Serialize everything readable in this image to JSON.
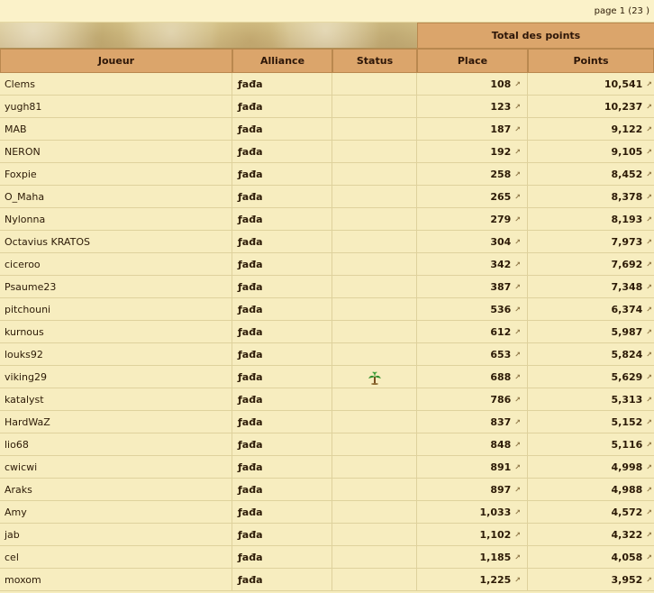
{
  "pager": {
    "text": "page 1 (23 )"
  },
  "table": {
    "group_header": "Total des points",
    "headers": {
      "player": "Joueur",
      "alliance": "Alliance",
      "status": "Status",
      "place": "Place",
      "points": "Points"
    },
    "link_icon_glyph": "↗",
    "rows": [
      {
        "player": "Clems",
        "alliance": "ƒađa",
        "status": "",
        "place": "108",
        "points": "10,541"
      },
      {
        "player": "yugh81",
        "alliance": "ƒađa",
        "status": "",
        "place": "123",
        "points": "10,237"
      },
      {
        "player": "MAB",
        "alliance": "ƒađa",
        "status": "",
        "place": "187",
        "points": "9,122"
      },
      {
        "player": "NERON",
        "alliance": "ƒađa",
        "status": "",
        "place": "192",
        "points": "9,105"
      },
      {
        "player": "Foxpie",
        "alliance": "ƒađa",
        "status": "",
        "place": "258",
        "points": "8,452"
      },
      {
        "player": "O_Maha",
        "alliance": "ƒađa",
        "status": "",
        "place": "265",
        "points": "8,378"
      },
      {
        "player": "Nylonna",
        "alliance": "ƒađa",
        "status": "",
        "place": "279",
        "points": "8,193"
      },
      {
        "player": "Octavius KRATOS",
        "alliance": "ƒađa",
        "status": "",
        "place": "304",
        "points": "7,973"
      },
      {
        "player": "ciceroo",
        "alliance": "ƒađa",
        "status": "",
        "place": "342",
        "points": "7,692"
      },
      {
        "player": "Psaume23",
        "alliance": "ƒađa",
        "status": "",
        "place": "387",
        "points": "7,348"
      },
      {
        "player": "pitchouni",
        "alliance": "ƒađa",
        "status": "",
        "place": "536",
        "points": "6,374"
      },
      {
        "player": "kurnous",
        "alliance": "ƒađa",
        "status": "",
        "place": "612",
        "points": "5,987"
      },
      {
        "player": "louks92",
        "alliance": "ƒađa",
        "status": "",
        "place": "653",
        "points": "5,824"
      },
      {
        "player": "viking29",
        "alliance": "ƒađa",
        "status": "palm-tree-icon",
        "place": "688",
        "points": "5,629"
      },
      {
        "player": "katalyst",
        "alliance": "ƒađa",
        "status": "",
        "place": "786",
        "points": "5,313"
      },
      {
        "player": "HardWaZ",
        "alliance": "ƒađa",
        "status": "",
        "place": "837",
        "points": "5,152"
      },
      {
        "player": "lio68",
        "alliance": "ƒađa",
        "status": "",
        "place": "848",
        "points": "5,116"
      },
      {
        "player": "cwicwi",
        "alliance": "ƒađa",
        "status": "",
        "place": "891",
        "points": "4,998"
      },
      {
        "player": "Araks",
        "alliance": "ƒađa",
        "status": "",
        "place": "897",
        "points": "4,988"
      },
      {
        "player": "Amy",
        "alliance": "ƒađa",
        "status": "",
        "place": "1,033",
        "points": "4,572"
      },
      {
        "player": "jab",
        "alliance": "ƒađa",
        "status": "",
        "place": "1,102",
        "points": "4,322"
      },
      {
        "player": "cel",
        "alliance": "ƒađa",
        "status": "",
        "place": "1,185",
        "points": "4,058"
      },
      {
        "player": "moxom",
        "alliance": "ƒađa",
        "status": "",
        "place": "1,225",
        "points": "3,952"
      }
    ]
  }
}
